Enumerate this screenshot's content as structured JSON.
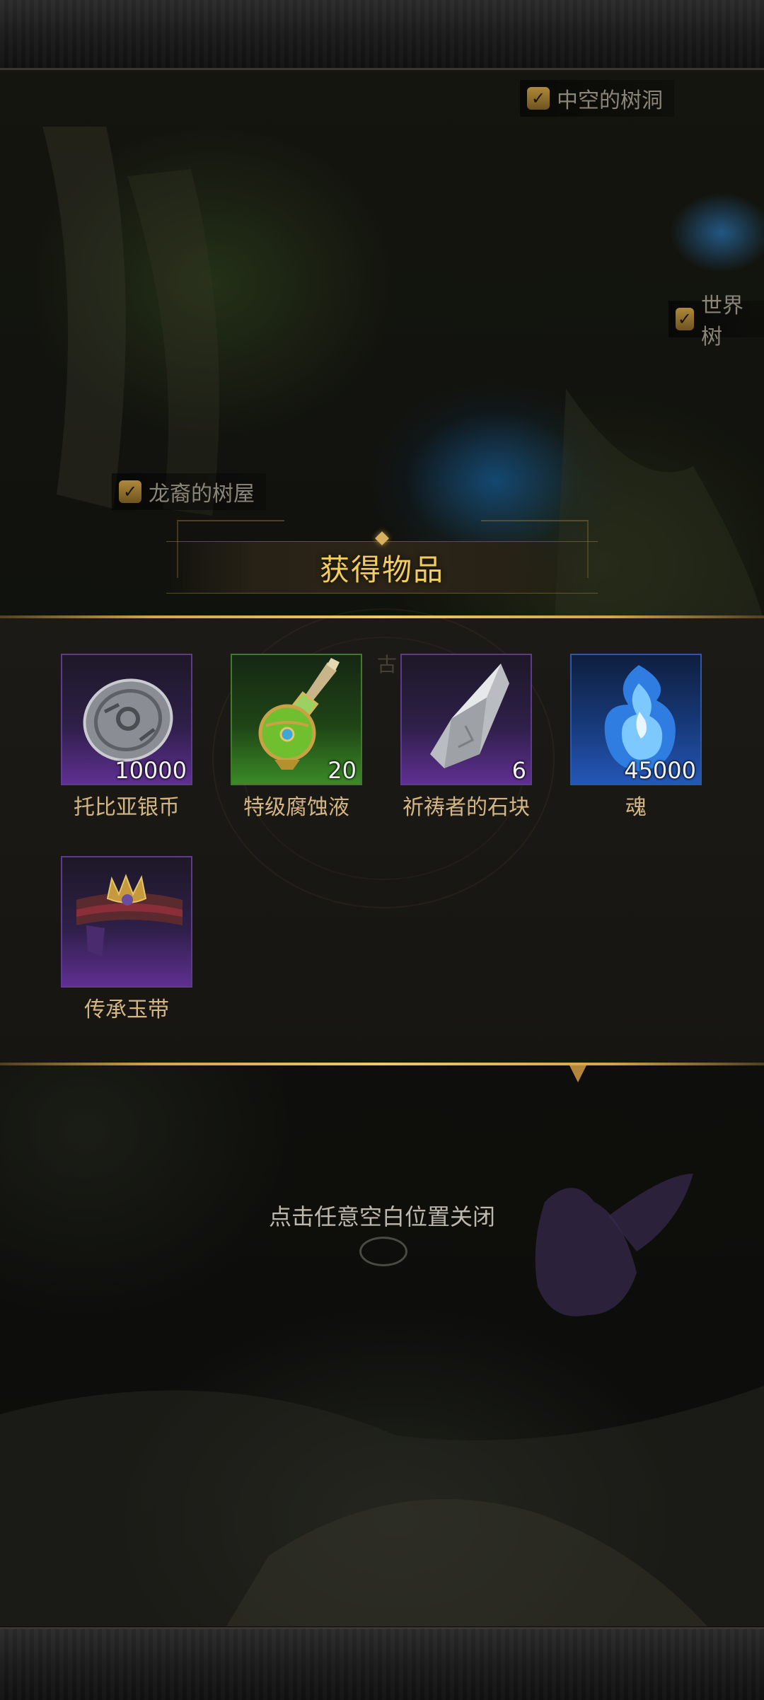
{
  "map": {
    "labels": [
      {
        "text": "中空的树洞"
      },
      {
        "text": "世界树"
      },
      {
        "text": "龙裔的树屋"
      }
    ],
    "partial_marker": "古"
  },
  "reward_dialog": {
    "title": "获得物品",
    "items": [
      {
        "name": "托比亚银币",
        "quantity": "10000",
        "rarity": "purple",
        "icon": "silver-coin-icon"
      },
      {
        "name": "特级腐蚀液",
        "quantity": "20",
        "rarity": "green",
        "icon": "potion-bottle-icon"
      },
      {
        "name": "祈祷者的石块",
        "quantity": "6",
        "rarity": "purple",
        "icon": "stone-icon"
      },
      {
        "name": "魂",
        "quantity": "45000",
        "rarity": "blue",
        "icon": "soul-flame-icon"
      },
      {
        "name": "传承玉带",
        "quantity": "",
        "rarity": "purple",
        "icon": "belt-icon"
      }
    ]
  },
  "close_hint": "点击任意空白位置关闭",
  "colors": {
    "title_gold": "#f2cc5c",
    "item_name": "#d4b683",
    "rarity_purple": "#5e2f92",
    "rarity_green": "#3a8a26",
    "rarity_blue": "#2457b8"
  }
}
